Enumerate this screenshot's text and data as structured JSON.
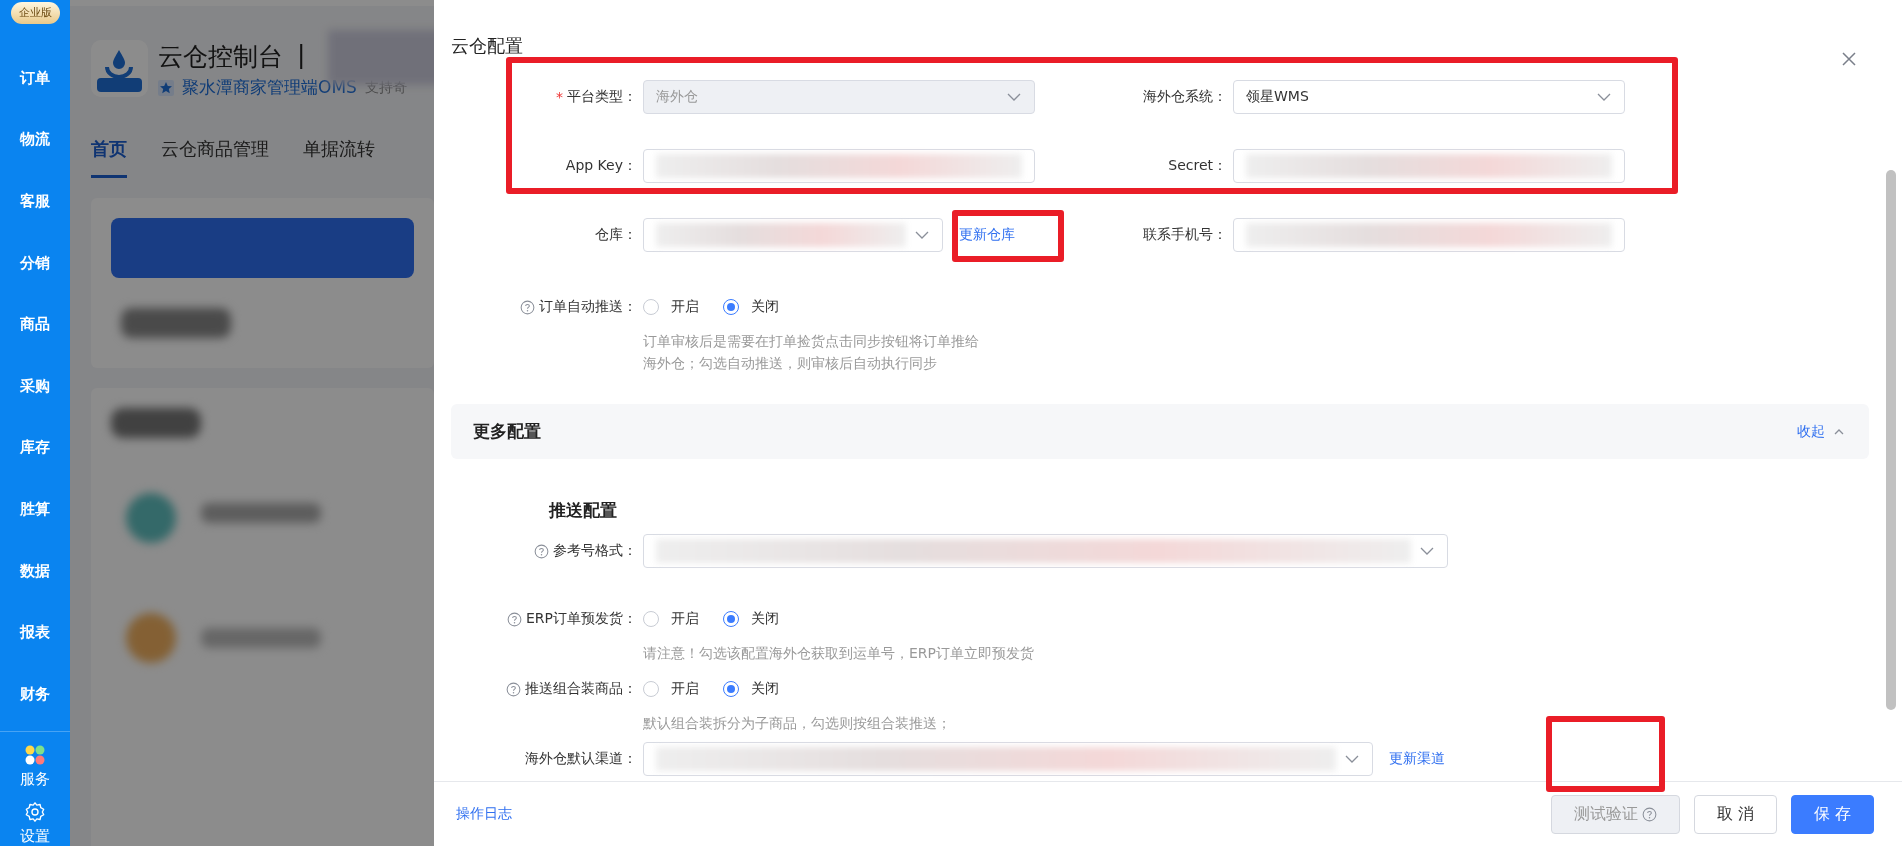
{
  "sidebar": {
    "badge": "企业版",
    "items": [
      {
        "label": "订单"
      },
      {
        "label": "物流"
      },
      {
        "label": "客服"
      },
      {
        "label": "分销"
      },
      {
        "label": "商品"
      },
      {
        "label": "采购"
      },
      {
        "label": "库存"
      },
      {
        "label": "胜算"
      },
      {
        "label": "数据"
      },
      {
        "label": "报表"
      },
      {
        "label": "财务"
      }
    ],
    "bottom_items": [
      {
        "label": "服务",
        "kind": "apps"
      },
      {
        "label": "设置",
        "kind": "settings"
      }
    ]
  },
  "background_page": {
    "title": "云仓控制台",
    "title_separator": "|",
    "subtitle": "聚水潭商家管理端OMS",
    "subtitle_note": "支持奇",
    "tabs": [
      {
        "label": "首页",
        "selected": true
      },
      {
        "label": "云仓商品管理",
        "selected": false
      },
      {
        "label": "单据流转",
        "selected": false
      }
    ]
  },
  "drawer": {
    "title": "云仓配置",
    "fields": [
      {
        "kind": "select",
        "required_mark": "*",
        "label": "平台类型：",
        "disabled": true,
        "redacted": false,
        "value": "海外仓"
      },
      {
        "kind": "select",
        "label": "海外仓系统：",
        "disabled": false,
        "redacted": false,
        "value": "领星WMS"
      },
      {
        "kind": "input",
        "label": "App Key：",
        "disabled": false,
        "redacted": true
      },
      {
        "kind": "input",
        "label": "Secret：",
        "disabled": false,
        "redacted": true
      },
      {
        "kind": "select",
        "label": "仓库：",
        "disabled": false,
        "redacted": true,
        "link": "更新仓库"
      },
      {
        "kind": "input",
        "label": "联系手机号：",
        "disabled": false,
        "redacted": true
      }
    ],
    "auto_push": {
      "label": "订单自动推送：",
      "help": true,
      "options": [
        {
          "label": "开启",
          "selected": false
        },
        {
          "label": "关闭",
          "selected": true
        }
      ],
      "hint": "订单审核后是需要在打单捡货点击同步按钮将订单推给海外仓；勾选自动推送，则审核后自动执行同步"
    },
    "more": {
      "title": "更多配置",
      "toggle": "收起",
      "expanded": true,
      "subsection": "推送配置",
      "rows": [
        {
          "kind": "select",
          "label": "参考号格式：",
          "help": true,
          "redacted": true
        },
        {
          "kind": "radio",
          "label": "ERP订单预发货：",
          "help": true,
          "options": [
            {
              "label": "开启",
              "selected": false
            },
            {
              "label": "关闭",
              "selected": true
            }
          ],
          "hint": "请注意！勾选该配置海外仓获取到运单号，ERP订单立即预发货"
        },
        {
          "kind": "radio",
          "label": "推送组合装商品：",
          "help": true,
          "options": [
            {
              "label": "开启",
              "selected": false
            },
            {
              "label": "关闭",
              "selected": true
            }
          ],
          "hint": "默认组合装拆分为子商品，勾选则按组合装推送；"
        },
        {
          "kind": "select",
          "label": "海外仓默认渠道：",
          "help": false,
          "redacted": true,
          "link": "更新渠道"
        }
      ]
    },
    "footer": {
      "log_link": "操作日志",
      "buttons": [
        {
          "label": "测试验证",
          "kind": "test",
          "disabled": true,
          "help": true
        },
        {
          "label": "取 消",
          "kind": "default",
          "disabled": false,
          "help": false
        },
        {
          "label": "保 存",
          "kind": "primary",
          "disabled": false,
          "help": false
        }
      ]
    }
  }
}
